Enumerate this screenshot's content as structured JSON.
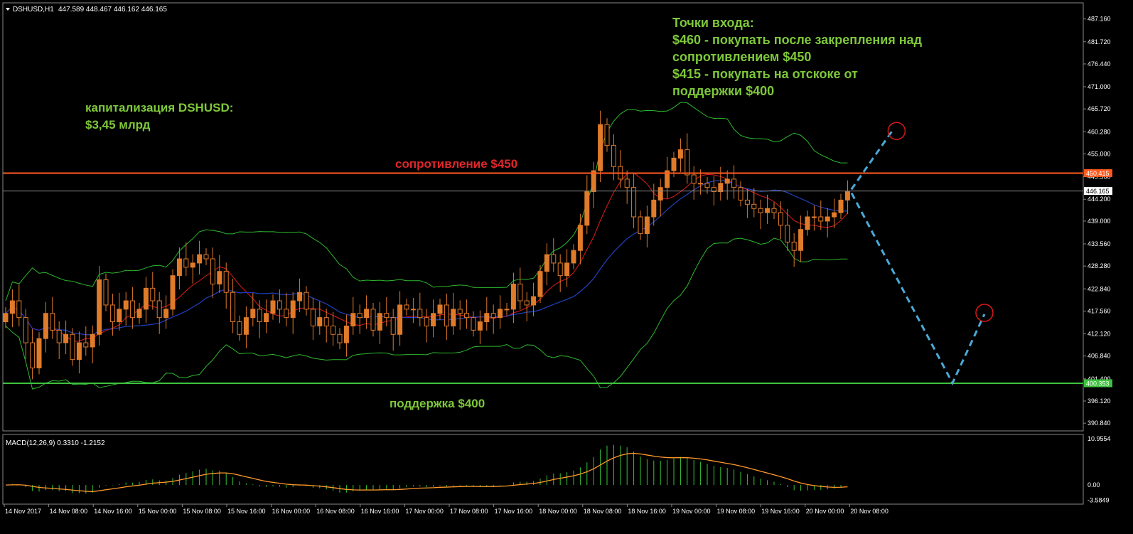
{
  "chart_data": {
    "type": "candlestick",
    "symbol_header": "DSHUSD,H1",
    "ohlc_header": "447.589 448.467 446.162 446.165",
    "price_axis_ticks": [
      "487.160",
      "481.720",
      "476.440",
      "471.000",
      "465.720",
      "460.280",
      "455.000",
      "449.560",
      "444.200",
      "439.000",
      "433.560",
      "428.280",
      "422.840",
      "417.560",
      "412.120",
      "406.840",
      "401.400",
      "396.120",
      "390.840"
    ],
    "price_range": [
      389.0,
      491.0
    ],
    "time_axis_labels": [
      "14 Nov 2017",
      "14 Nov 08:00",
      "14 Nov 16:00",
      "15 Nov 00:00",
      "15 Nov 08:00",
      "15 Nov 16:00",
      "16 Nov 00:00",
      "16 Nov 08:00",
      "16 Nov 16:00",
      "17 Nov 00:00",
      "17 Nov 08:00",
      "17 Nov 16:00",
      "18 Nov 00:00",
      "18 Nov 08:00",
      "18 Nov 16:00",
      "19 Nov 00:00",
      "19 Nov 08:00",
      "19 Nov 16:00",
      "20 Nov 00:00",
      "20 Nov 08:00"
    ],
    "current_price_label": "446.165",
    "current_price": 446.165,
    "resistance": {
      "label": "сопротивление $450",
      "level": 450.415,
      "tag": "450.415",
      "color": "#ff5a1f"
    },
    "support": {
      "label": "поддержка $400",
      "level": 400.353,
      "tag": "400.353",
      "color": "#3ec23e"
    },
    "annotations": {
      "cap_line1": "капитализация DSHUSD:",
      "cap_line2": "$3,45 млрд",
      "entry_title": "Точки входа:",
      "entry_line1": "$460 - покупать после закрепления над",
      "entry_line2": "сопротивлением $450",
      "entry_line3": "$415 - покупать на отскоке от",
      "entry_line4": "поддержки $400"
    },
    "forecast_path": [
      [
        446.2,
        460.3
      ],
      [
        400.4
      ],
      [
        416.8
      ]
    ],
    "target_circles": [
      460.3,
      416.8
    ],
    "candles_close": [
      417,
      420,
      416,
      410,
      404,
      411,
      417,
      413,
      410,
      412,
      406,
      410,
      409,
      412,
      425,
      419,
      415,
      418,
      420,
      416,
      418,
      423,
      420,
      416,
      418,
      426,
      430,
      428,
      429,
      431,
      430,
      424,
      427,
      422,
      415,
      412,
      416,
      418,
      415,
      417,
      420,
      418,
      416,
      420,
      422,
      418,
      414,
      416,
      414,
      412,
      410,
      414,
      417,
      416,
      418,
      413,
      417,
      416,
      412,
      419,
      418,
      418,
      416,
      414,
      417,
      419,
      414,
      418,
      417,
      416,
      413,
      415,
      417,
      416,
      418,
      418,
      424,
      420,
      419,
      421,
      427,
      431,
      429,
      426,
      429,
      432,
      438,
      446,
      451,
      462,
      457,
      452,
      449,
      447,
      440,
      436,
      440,
      444,
      447,
      451,
      454,
      456,
      450,
      448,
      448,
      447,
      446,
      448,
      449,
      447,
      444,
      443,
      442,
      441,
      442,
      441,
      438,
      434,
      432,
      437,
      440,
      440,
      439,
      440,
      441,
      444,
      446
    ],
    "macd": {
      "label": "MACD(12,26,9) 0.3310 -1.2152",
      "axis_ticks": [
        "10.9554",
        "0.00",
        "-3.5849"
      ],
      "range": [
        -4.2,
        11.5
      ]
    },
    "colors": {
      "bull": "#e07b2a",
      "bear": "#e07b2a",
      "ma_red": "#e01b1b",
      "ma_blue": "#2230d8",
      "bands": "#2eb82e",
      "forecast": "#4ba9d6",
      "circle": "#d41a1a",
      "macd_hist": "#35c635",
      "macd_signal": "#ff9a2a"
    }
  }
}
